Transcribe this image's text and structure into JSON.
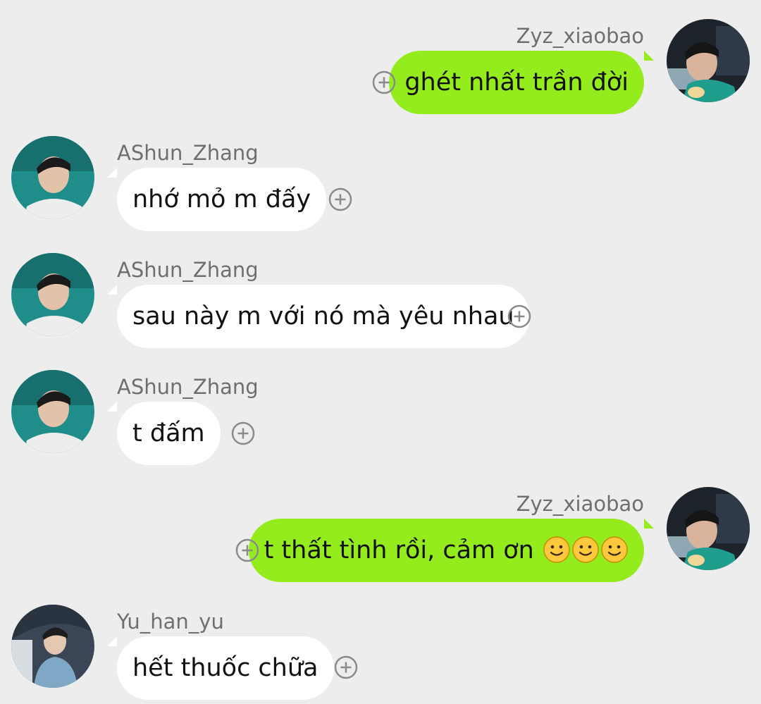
{
  "messages": [
    {
      "sender": "Zyz_xiaobao",
      "text": "ghét nhất trần đời",
      "side": "out"
    },
    {
      "sender": "AShun_Zhang",
      "text": "nhớ mỏ m đấy",
      "side": "in"
    },
    {
      "sender": "AShun_Zhang",
      "text": "sau này m với nó mà yêu nhau",
      "side": "in"
    },
    {
      "sender": "AShun_Zhang",
      "text": "t đấm",
      "side": "in"
    },
    {
      "sender": "Zyz_xiaobao",
      "text": "t thất tình rồi, cảm ơn",
      "side": "out"
    },
    {
      "sender": "Yu_han_yu",
      "text": "hết thuốc chữa",
      "side": "in"
    }
  ],
  "icons": {
    "add_reaction": "plus-circle-icon",
    "emoji": "slightly-smiling-face-icon"
  },
  "colors": {
    "background": "#ededed",
    "incoming_bubble": "#ffffff",
    "outgoing_bubble": "#95ec1c",
    "sender_name": "#6f6f6f",
    "message_text": "#111111"
  }
}
